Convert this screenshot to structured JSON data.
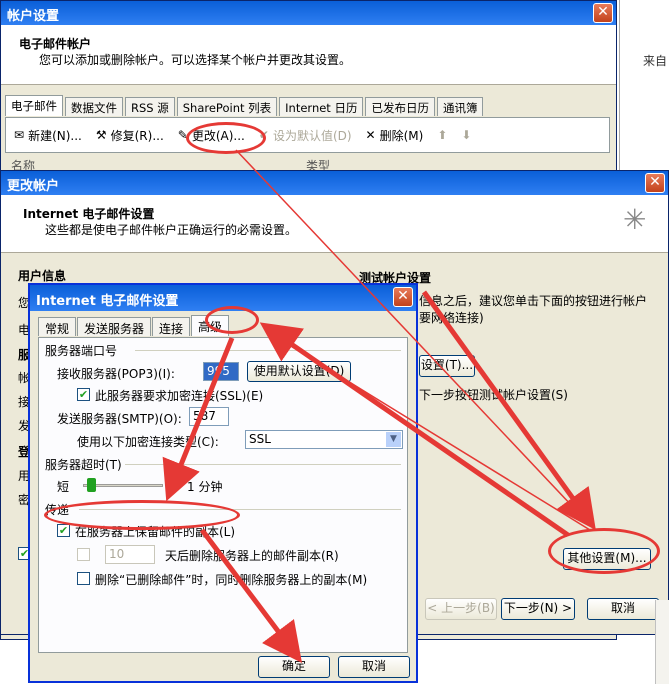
{
  "bg_window": {
    "title": "帐户设置",
    "header_title": "电子邮件帐户",
    "header_desc": "您可以添加或删除帐户。可以选择某个帐户并更改其设置。",
    "tabs": [
      "电子邮件",
      "数据文件",
      "RSS 源",
      "SharePoint 列表",
      "Internet 日历",
      "已发布日历",
      "通讯簿"
    ],
    "toolbar": {
      "new": "新建(N)...",
      "repair": "修复(R)...",
      "change": "更改(A)...",
      "default": "设为默认值(D)",
      "delete": "删除(M)"
    },
    "columns": [
      "名称",
      "类型"
    ],
    "right_text": "来自"
  },
  "change_window": {
    "title": "更改帐户",
    "header_title": "Internet 电子邮件设置",
    "header_desc": "这些都是使电子邮件帐户正确运行的必需设置。",
    "user_info": "用户信息",
    "test_title": "测试帐户设置",
    "test_line1": "信息之后，建议您单击下面的按钮进行帐户",
    "test_line2": "要网络连接)",
    "test_button": "设置(T)...",
    "next_hint": "下一步按钮测试帐户设置(S)",
    "left_frags": [
      "您",
      "电",
      "服",
      "帐",
      "接",
      "发",
      "登",
      "用",
      "密"
    ],
    "other_settings": "其他设置(M)...",
    "back": "< 上一步(B)",
    "next": "下一步(N) >",
    "cancel": "取消"
  },
  "dialog": {
    "title": "Internet 电子邮件设置",
    "tabs": [
      "常规",
      "发送服务器",
      "连接",
      "高级"
    ],
    "ports_group": "服务器端口号",
    "pop3_label": "接收服务器(POP3)(I):",
    "pop3_value": "995",
    "default_btn": "使用默认设置(D)",
    "ssl_check": "此服务器要求加密连接(SSL)(E)",
    "smtp_label": "发送服务器(SMTP)(O):",
    "smtp_value": "587",
    "enc_label": "使用以下加密连接类型(C):",
    "enc_value": "SSL",
    "timeout_group": "服务器超时(T)",
    "timeout_short": "短",
    "timeout_value": "1 分钟",
    "delivery_group": "传递",
    "keep_copy": "在服务器上保留邮件的副本(L)",
    "remove_after_days": "10",
    "remove_after_text": "天后删除服务器上的邮件副本(R)",
    "remove_deleted": "删除“已删除邮件”时，同时删除服务器上的副本(M)",
    "ok": "确定",
    "cancel": "取消"
  },
  "colors": {
    "annotation": "#e53935",
    "title_blue": "#0a5fd8"
  }
}
